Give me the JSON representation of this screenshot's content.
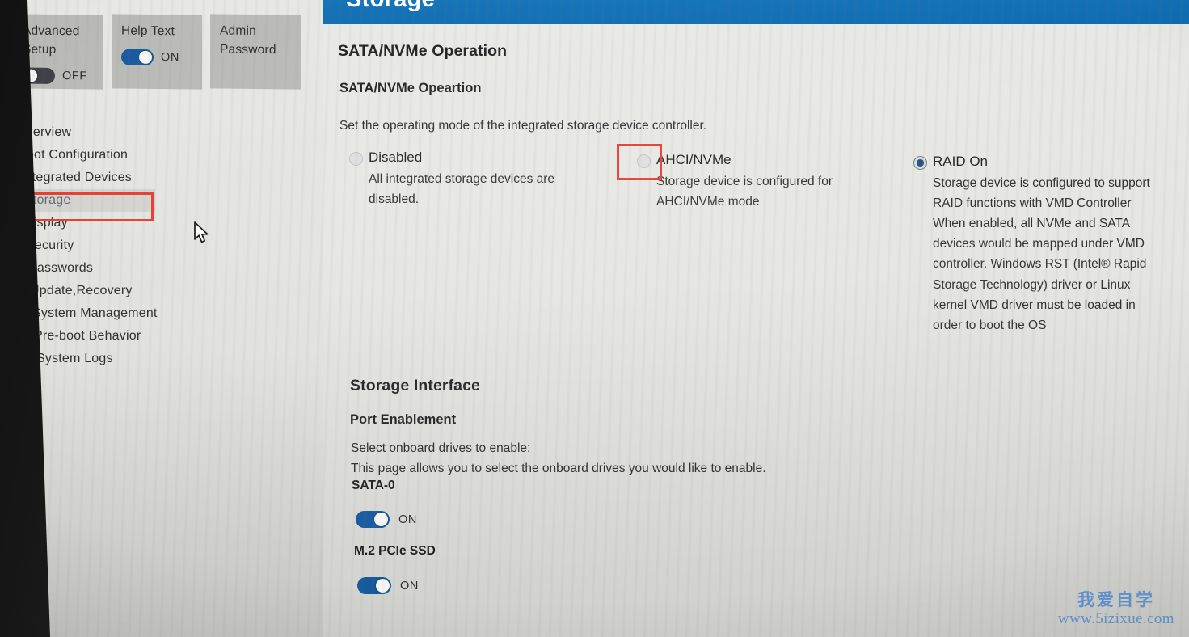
{
  "header": {
    "title": "Storage",
    "accent_color": "#0f6cb1"
  },
  "left_panel": {
    "option_cards": [
      {
        "label_line1": "Advanced",
        "label_line2": "Setup",
        "toggle_state": "OFF",
        "has_toggle": true
      },
      {
        "label_line1": "Help Text",
        "label_line2": "",
        "toggle_state": "ON",
        "has_toggle": true
      },
      {
        "label_line1": "Admin",
        "label_line2": "Password",
        "toggle_state": "",
        "has_toggle": false
      }
    ],
    "nav_items": [
      {
        "label": "Overview",
        "selected": false
      },
      {
        "label": "Boot Configuration",
        "selected": false
      },
      {
        "label": "Integrated Devices",
        "selected": false
      },
      {
        "label": "Storage",
        "selected": true
      },
      {
        "label": "Display",
        "selected": false
      },
      {
        "label": "Security",
        "selected": false
      },
      {
        "label": "Passwords",
        "selected": false
      },
      {
        "label": "Update,Recovery",
        "selected": false
      },
      {
        "label": "System Management",
        "selected": false
      },
      {
        "label": "Pre-boot Behavior",
        "selected": false
      },
      {
        "label": "System Logs",
        "selected": false
      }
    ]
  },
  "main": {
    "section_title": "SATA/NVMe Operation",
    "sub_title": "SATA/NVMe Opeartion",
    "description": "Set the operating mode of the integrated storage device controller.",
    "options": [
      {
        "name": "Disabled",
        "desc_lines": [
          "All integrated storage devices are",
          "disabled."
        ],
        "selected": false
      },
      {
        "name": "AHCI/NVMe",
        "desc_lines": [
          "Storage device is configured for",
          "AHCI/NVMe mode"
        ],
        "selected": false
      },
      {
        "name": "RAID On",
        "desc_lines": [
          "Storage device is configured to support",
          "RAID functions with VMD Controller",
          "When enabled, all NVMe and SATA",
          "devices would be mapped under VMD",
          "controller. Windows RST (Intel® Rapid",
          "Storage Technology) driver or Linux",
          "kernel VMD driver must be loaded in",
          "order to boot the OS"
        ],
        "selected": true
      }
    ],
    "storage_interface": {
      "section_title": "Storage Interface",
      "sub_title": "Port Enablement",
      "desc_line1": "Select onboard drives to enable:",
      "desc_line2": "This page allows you to select the onboard drives you would like to enable.",
      "ports": [
        {
          "label": "SATA-0",
          "toggle_state": "ON"
        },
        {
          "label": "M.2 PCIe SSD",
          "toggle_state": "ON"
        }
      ]
    }
  },
  "annotations": {
    "highlight_color": "#e8392b",
    "nav_highlight_target": "Storage",
    "radio_highlight_target": "AHCI/NVMe"
  },
  "watermark": {
    "chinese": "我爱自学",
    "url": "www.5izixue.com",
    "color": "#5b92d6"
  }
}
